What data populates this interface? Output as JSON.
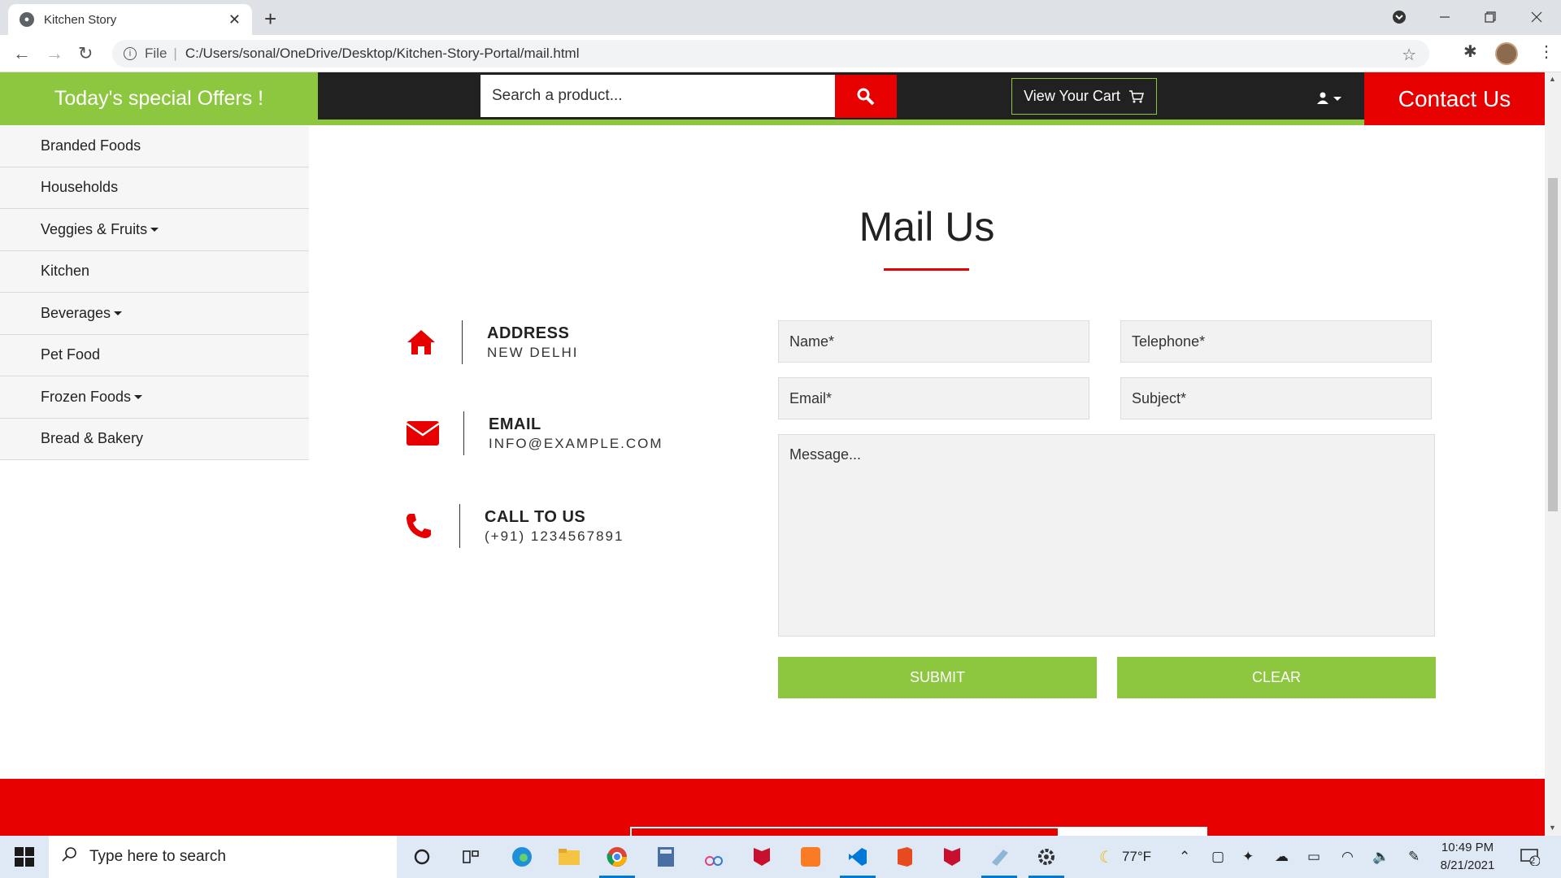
{
  "browser": {
    "tab_title": "Kitchen Story",
    "tab_close": "✕",
    "new_tab": "+",
    "address_prefix": "File",
    "url": "C:/Users/sonal/OneDrive/Desktop/Kitchen-Story-Portal/mail.html"
  },
  "header": {
    "offers": "Today's special Offers !",
    "search_placeholder": "Search a product...",
    "cart_label": "View Your Cart",
    "contact_label": "Contact Us"
  },
  "sidebar": {
    "items": [
      {
        "label": "Branded Foods",
        "dropdown": false
      },
      {
        "label": "Households",
        "dropdown": false
      },
      {
        "label": "Veggies & Fruits",
        "dropdown": true
      },
      {
        "label": "Kitchen",
        "dropdown": false
      },
      {
        "label": "Beverages",
        "dropdown": true
      },
      {
        "label": "Pet Food",
        "dropdown": false
      },
      {
        "label": "Frozen Foods",
        "dropdown": true
      },
      {
        "label": "Bread & Bakery",
        "dropdown": false
      }
    ]
  },
  "main": {
    "title": "Mail Us",
    "contact": [
      {
        "heading": "ADDRESS",
        "value": "NEW DELHI",
        "icon": "home-icon"
      },
      {
        "heading": "EMAIL",
        "value": "INFO@EXAMPLE.COM",
        "icon": "envelope-icon"
      },
      {
        "heading": "CALL TO US",
        "value": "(+91) 1234567891",
        "icon": "phone-icon"
      }
    ],
    "form": {
      "name_placeholder": "Name*",
      "telephone_placeholder": "Telephone*",
      "email_placeholder": "Email*",
      "subject_placeholder": "Subject*",
      "message_placeholder": "Message...",
      "submit_label": "SUBMIT",
      "clear_label": "CLEAR"
    }
  },
  "taskbar": {
    "search_placeholder": "Type here to search",
    "weather": "77°F",
    "time": "10:49 PM",
    "date": "8/21/2021",
    "notifications": "2"
  },
  "colors": {
    "accent_green": "#8dc63f",
    "accent_red": "#e60000",
    "header_dark": "#212121"
  }
}
